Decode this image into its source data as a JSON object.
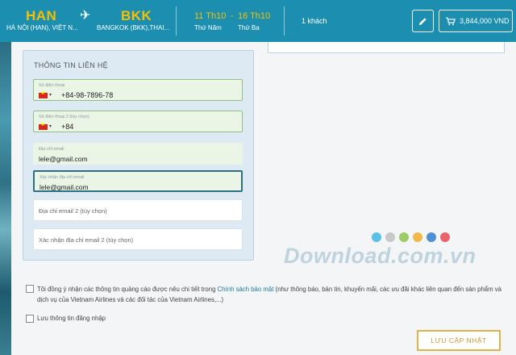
{
  "header": {
    "origin_code": "HAN",
    "origin_city": "HÀ NỘI (HAN), VIỆT N...",
    "dest_code": "BKK",
    "dest_city": "BANGKOK (BKK),THAI...",
    "depart_date": "11 Th10",
    "date_sep": "-",
    "return_date": "16 Th10",
    "depart_day": "Thứ Năm",
    "return_day": "Thứ Ba",
    "guests": "1 khách",
    "cart_total": "3,844,000 VND",
    "icons": [
      "plane-icon",
      "pencil-icon",
      "cart-icon"
    ]
  },
  "contact": {
    "title": "THÔNG TIN LIÊN HỆ",
    "phone": {
      "label": "Số điện thoại",
      "value": "+84-98-7896-78"
    },
    "phone2": {
      "label": "Số điện thoại 2 (tùy chọn)",
      "value": "+84"
    },
    "email": {
      "label": "Địa chỉ email",
      "value": "lele@gmail.com"
    },
    "email_confirm": {
      "label": "Xác nhận địa chỉ email",
      "value": "lele@gmail.com"
    },
    "email2": {
      "placeholder": "Địa chỉ email 2 (tùy chọn)"
    },
    "email2_confirm": {
      "placeholder": "Xác nhận địa chỉ email 2 (tùy chọn)"
    },
    "flag_caret": "▾"
  },
  "consent": {
    "text_before": "Tôi đồng ý nhận các thông tin quảng cáo được nêu chi tiết trong ",
    "link": "Chính sách bảo mật",
    "text_after": " (như thông báo, bản tin, khuyến mãi, các ưu đãi khác liên quan đến sản phẩm và dịch vụ của Vietnam Airlines và các đối tác của Vietnam Airlines,...)",
    "save_login": "Lưu thông tin đăng nhập"
  },
  "update_button": "LƯU CẬP NHẬT",
  "watermark": {
    "text": "Download.com.vn",
    "dot_colors": [
      "#5bc0e8",
      "#c8c8c8",
      "#9ccc65",
      "#f2b84b",
      "#4f8fd6",
      "#e8646a"
    ]
  },
  "colors": {
    "header_bg": "#1c8fb0",
    "accent_yellow": "#f5c000",
    "button_gold": "#e0b34a"
  }
}
